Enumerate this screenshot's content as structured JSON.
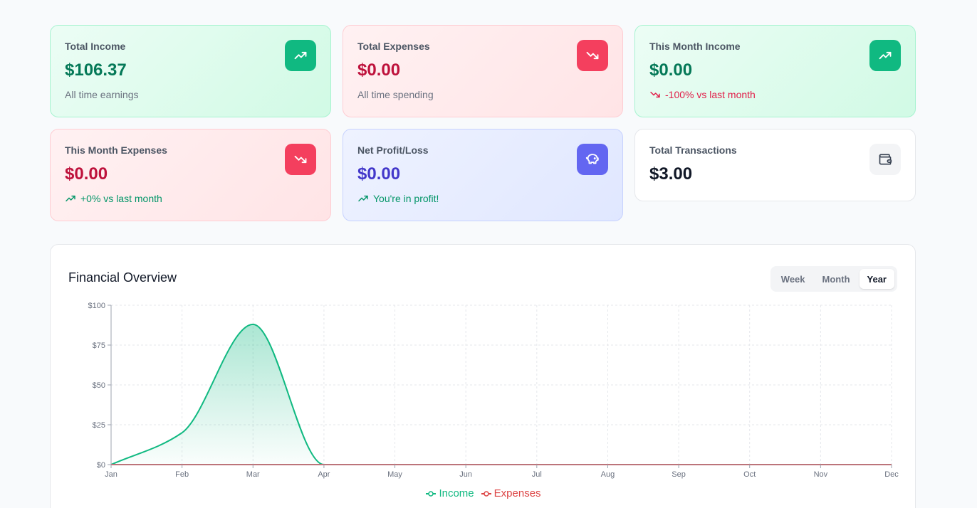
{
  "cards": [
    {
      "title": "Total Income",
      "value": "$106.37",
      "sub": "All time earnings"
    },
    {
      "title": "Total Expenses",
      "value": "$0.00",
      "sub": "All time spending"
    },
    {
      "title": "This Month Income",
      "value": "$0.00",
      "sub": "-100% vs last month"
    },
    {
      "title": "This Month Expenses",
      "value": "$0.00",
      "sub": "+0% vs last month"
    },
    {
      "title": "Net Profit/Loss",
      "value": "$0.00",
      "sub": "You're in profit!"
    },
    {
      "title": "Total Transactions",
      "value": "$3.00"
    }
  ],
  "icons": {
    "income": "trending-up-icon",
    "expenses": "trending-down-icon",
    "profit": "piggy-bank-icon",
    "transactions": "wallet-icon"
  },
  "colors": {
    "income": "#10b981",
    "expenses": "#dc4444",
    "profit": "#6366f1"
  },
  "overview": {
    "title": "Financial Overview",
    "ranges": [
      "Week",
      "Month",
      "Year"
    ],
    "active_range": "Year"
  },
  "chart_data": {
    "type": "area",
    "categories": [
      "Jan",
      "Feb",
      "Mar",
      "Apr",
      "May",
      "Jun",
      "Jul",
      "Aug",
      "Sep",
      "Oct",
      "Nov",
      "Dec"
    ],
    "series": [
      {
        "name": "Income",
        "values": [
          0,
          20,
          88,
          0,
          0,
          0,
          0,
          0,
          0,
          0,
          0,
          0
        ]
      },
      {
        "name": "Expenses",
        "values": [
          0,
          0,
          0,
          0,
          0,
          0,
          0,
          0,
          0,
          0,
          0,
          0
        ]
      }
    ],
    "y_ticks": [
      "$0",
      "$25",
      "$50",
      "$75",
      "$100"
    ],
    "ylim": [
      0,
      100
    ],
    "grid": true,
    "legend": "bottom-center"
  }
}
